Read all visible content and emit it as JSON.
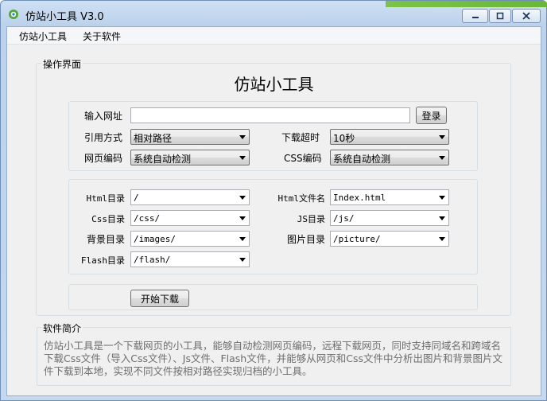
{
  "window": {
    "title": "仿站小工具 V3.0",
    "minimize_icon": "minimize-icon",
    "maximize_icon": "maximize-icon",
    "close_icon": "close-icon"
  },
  "menu": {
    "items": [
      {
        "label": "仿站小工具"
      },
      {
        "label": "关于软件"
      }
    ]
  },
  "operation": {
    "legend": "操作界面",
    "heading": "仿站小工具",
    "url_label": "输入网址",
    "url_value": "",
    "login_button": "登录",
    "ref_mode_label": "引用方式",
    "ref_mode_value": "相对路径",
    "timeout_label": "下载超时",
    "timeout_value": "10秒",
    "encoding_label": "网页编码",
    "encoding_value": "系统自动检测",
    "css_encoding_label": "CSS编码",
    "css_encoding_value": "系统自动检测",
    "html_dir_label": "Html目录",
    "html_dir_value": "/",
    "html_file_label": "Html文件名",
    "html_file_value": "Index.html",
    "css_dir_label": "Css目录",
    "css_dir_value": "/css/",
    "js_dir_label": "JS目录",
    "js_dir_value": "/js/",
    "bg_dir_label": "背景目录",
    "bg_dir_value": "/images/",
    "img_dir_label": "图片目录",
    "img_dir_value": "/picture/",
    "flash_dir_label": "Flash目录",
    "flash_dir_value": "/flash/",
    "start_button": "开始下载"
  },
  "intro": {
    "legend": "软件简介",
    "text": "仿站小工具是一个下载网页的小工具，能够自动检测网页编码，远程下载网页，同时支持同域名和跨域名下载Css文件（导入Css文件）、Js文件、Flash文件，并能够从网页和Css文件中分析出图片和背景图片文件下载到本地，实现不同文件按相对路径实现归档的小工具。"
  }
}
